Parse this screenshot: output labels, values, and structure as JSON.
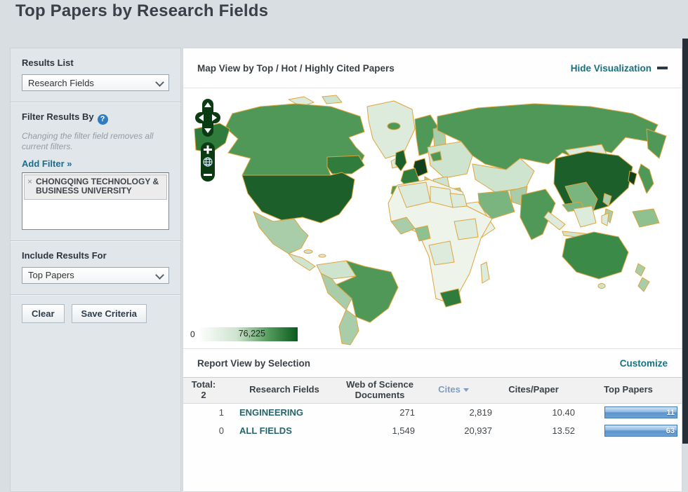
{
  "page": {
    "title": "Top Papers by Research Fields"
  },
  "sidebar": {
    "results_list": {
      "label": "Results List",
      "value": "Research Fields"
    },
    "filter": {
      "label": "Filter Results By",
      "help_glyph": "?",
      "note": "Changing the filter field removes all current filters.",
      "add_filter": "Add Filter »",
      "chip_remove": "×",
      "chip_label": "CHONGQING TECHNOLOGY & BUSINESS UNIVERSITY"
    },
    "include": {
      "label": "Include Results For",
      "value": "Top Papers"
    },
    "actions": {
      "clear": "Clear",
      "save": "Save Criteria"
    }
  },
  "map": {
    "title": "Map View by Top / Hot / Highly Cited Papers",
    "hide_label": "Hide Visualization",
    "legend": {
      "min": "0",
      "max": "76,225"
    },
    "colors": {
      "dark_green": "#1c5f2b",
      "medium_green": "#4f9858",
      "light_green": "#a8cda8",
      "pale_green": "#dcebdc",
      "border_orange": "#dfa43c",
      "legend_max": "#0b5a1e",
      "control_green": "#0b3b13"
    }
  },
  "report": {
    "title": "Report View by Selection",
    "customize_label": "Customize",
    "total_label": "Total:",
    "total_value": "2",
    "columns": {
      "field": "Research Fields",
      "docs": "Web of Science Documents",
      "cites": "Cites",
      "cpp": "Cites/Paper",
      "top": "Top Papers"
    },
    "rows": [
      {
        "rank": "1",
        "field": "ENGINEERING",
        "docs": "271",
        "cites": "2,819",
        "cpp": "10.40",
        "top": "11"
      },
      {
        "rank": "0",
        "field": "ALL FIELDS",
        "docs": "1,549",
        "cites": "20,937",
        "cpp": "13.52",
        "top": "63"
      }
    ],
    "accent": {
      "link_teal": "#17707f",
      "bar_blue": "#5b94cb",
      "cites_blue": "#7f9dc2"
    }
  }
}
